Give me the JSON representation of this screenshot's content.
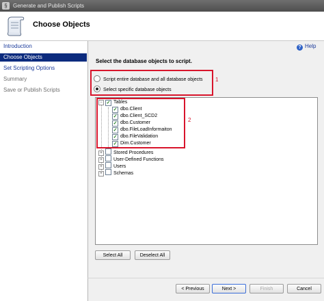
{
  "window": {
    "title": "Generate and Publish Scripts"
  },
  "header": {
    "title": "Choose Objects"
  },
  "nav": {
    "items": [
      {
        "label": "Introduction"
      },
      {
        "label": "Choose Objects"
      },
      {
        "label": "Set Scripting Options"
      },
      {
        "label": "Summary"
      },
      {
        "label": "Save or Publish Scripts"
      }
    ]
  },
  "help": {
    "label": "Help"
  },
  "main": {
    "heading": "Select the database objects to script.",
    "radio_all": "Script entire database and all database objects",
    "radio_specific": "Select specific database objects",
    "selected_option": "Select specific database objects",
    "annotation_1": "1",
    "annotation_2": "2"
  },
  "tree": {
    "tables": {
      "label": "Tables",
      "checked": true,
      "expanded": true
    },
    "tables_children": [
      {
        "label": "dbo.Client",
        "checked": true
      },
      {
        "label": "dbo.Client_SCD2",
        "checked": true
      },
      {
        "label": "dbo.Customer",
        "checked": true
      },
      {
        "label": "dbo.FileLoadInformaiton",
        "checked": true
      },
      {
        "label": "dbo.FileValidation",
        "checked": true
      },
      {
        "label": "Dim.Customer",
        "checked": true
      }
    ],
    "others": [
      {
        "label": "Stored Procedures",
        "checked": false
      },
      {
        "label": "User-Defined Functions",
        "checked": false
      },
      {
        "label": "Users",
        "checked": false
      },
      {
        "label": "Schemas",
        "checked": false
      }
    ]
  },
  "buttons": {
    "select_all": "Select All",
    "deselect_all": "Deselect All",
    "previous": "< Previous",
    "next": "Next >",
    "finish": "Finish",
    "cancel": "Cancel"
  },
  "colors": {
    "annotation": "#d8142b",
    "nav_selected": "#0c2b7e",
    "link": "#1a3a9a"
  }
}
